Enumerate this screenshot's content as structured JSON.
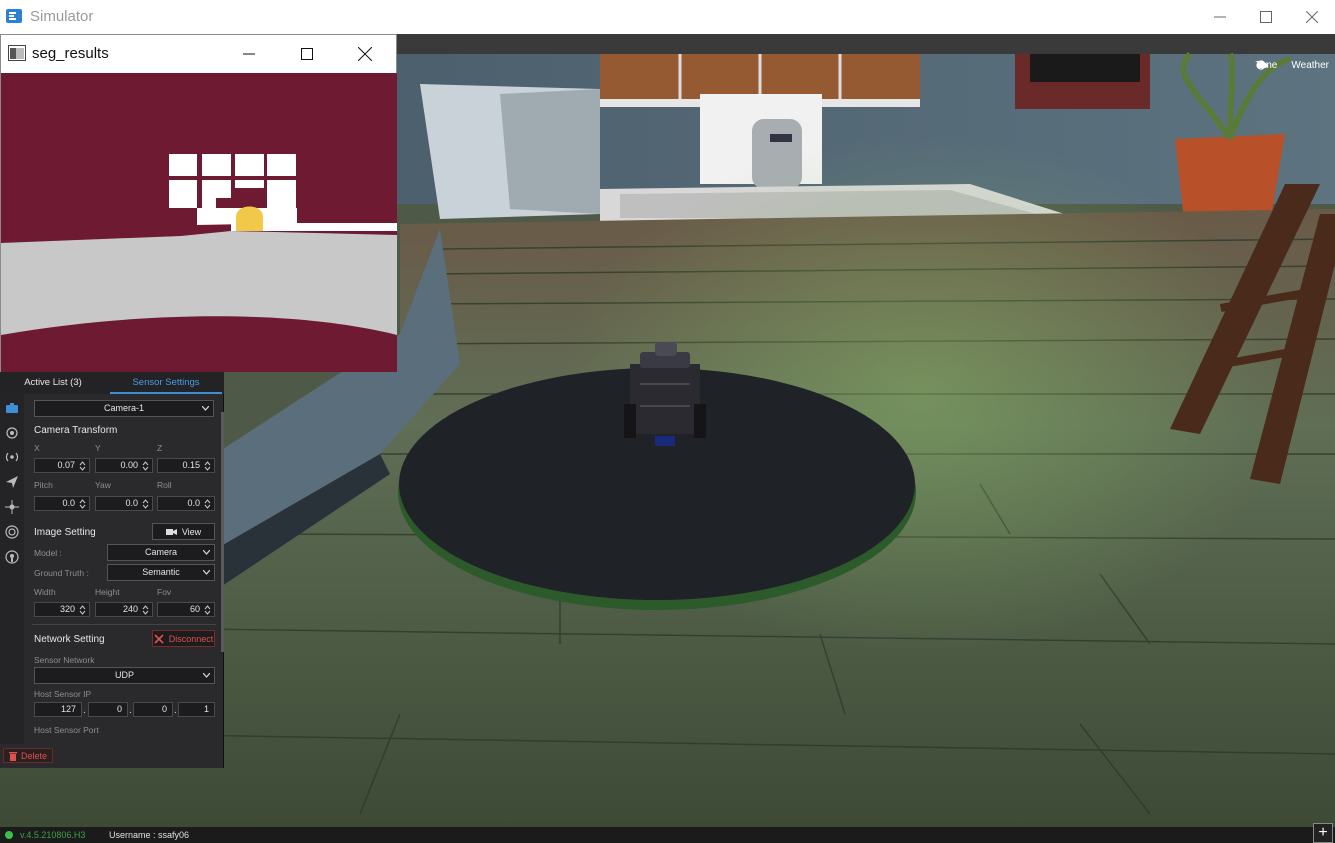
{
  "window": {
    "title": "Simulator"
  },
  "topright": {
    "time_label": "Time",
    "weather_label": "Weather"
  },
  "seg_window": {
    "title": "seg_results"
  },
  "panel": {
    "tabs": [
      {
        "label": "Active List  (3)"
      },
      {
        "label": "Sensor Settings"
      }
    ],
    "sensor_select": "Camera-1",
    "camera_transform_title": "Camera Transform",
    "transform_labels": {
      "x": "X",
      "y": "Y",
      "z": "Z",
      "pitch": "Pitch",
      "yaw": "Yaw",
      "roll": "Roll"
    },
    "transform_values": {
      "x": "0.07",
      "y": "0.00",
      "z": "0.15",
      "pitch": "0.0",
      "yaw": "0.0",
      "roll": "0.0"
    },
    "image_setting_title": "Image Setting",
    "view_button": "View",
    "model_label": "Model :",
    "model_value": "Camera",
    "ground_truth_label": "Ground Truth :",
    "ground_truth_value": "Semantic",
    "size_labels": {
      "width": "Width",
      "height": "Height",
      "fov": "Fov"
    },
    "size_values": {
      "width": "320",
      "height": "240",
      "fov": "60"
    },
    "network_setting_title": "Network Setting",
    "disconnect_button": "Disconnect",
    "sensor_network_label": "Sensor Network",
    "sensor_network_value": "UDP",
    "host_ip_label": "Host Sensor IP",
    "host_ip": [
      "127",
      "0",
      "0",
      "1"
    ],
    "host_port_label": "Host Sensor Port",
    "delete_button": "Delete"
  },
  "status": {
    "version": "v.4.5.210806.H3",
    "username": "Username : ssafy06"
  },
  "colors": {
    "accent": "#3f8fd8",
    "danger": "#e05050",
    "seg_background": "#6e1a32",
    "seg_floor": "#c8c8c8",
    "seg_object": "#f2c84b"
  }
}
